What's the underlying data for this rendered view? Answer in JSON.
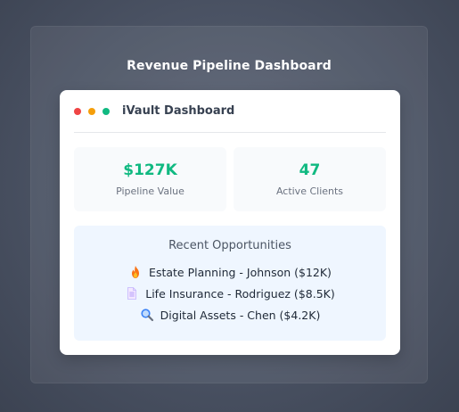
{
  "page": {
    "title": "Revenue Pipeline Dashboard"
  },
  "window": {
    "title": "iVault Dashboard",
    "controls": [
      {
        "name": "close",
        "color": "#ef4444"
      },
      {
        "name": "minimize",
        "color": "#f59e0b"
      },
      {
        "name": "maximize",
        "color": "#10b981"
      }
    ]
  },
  "stats": [
    {
      "value": "$127K",
      "label": "Pipeline Value"
    },
    {
      "value": "47",
      "label": "Active Clients"
    }
  ],
  "opportunities": {
    "title": "Recent Opportunities",
    "items": [
      {
        "icon": "fire-icon",
        "text": "Estate Planning - Johnson ($12K)"
      },
      {
        "icon": "document-icon",
        "text": "Life Insurance - Rodriguez ($8.5K)"
      },
      {
        "icon": "magnifier-icon",
        "text": "Digital Assets - Chen ($4.2K)"
      }
    ]
  },
  "colors": {
    "accent": "#10b981",
    "card_bg": "#ffffff",
    "list_bg": "#eff6ff"
  }
}
